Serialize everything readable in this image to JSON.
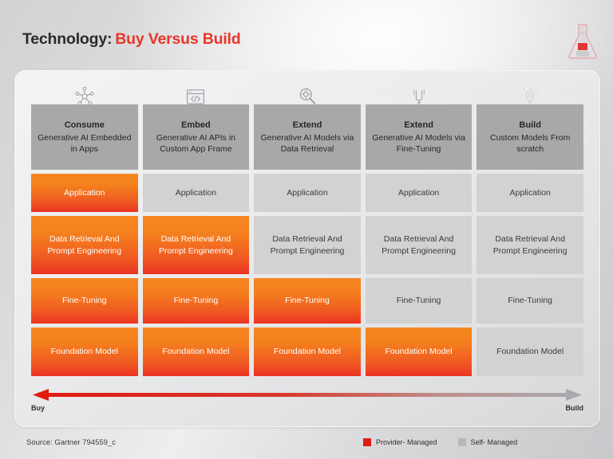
{
  "title": {
    "prefix": "Technology:",
    "highlight": "Buy Versus Build"
  },
  "logo": {
    "name": "flask-logo"
  },
  "columns": [
    {
      "icon": "network-hub-icon",
      "heading": "Consume",
      "subheading": "Generative AI Embedded in Apps"
    },
    {
      "icon": "code-window-icon",
      "heading": "Embed",
      "subheading": "Generative AI APIs in Custom App Frame"
    },
    {
      "icon": "magnifier-icon",
      "heading": "Extend",
      "subheading": "Generative AI Models via Data Retrieval"
    },
    {
      "icon": "tuning-fork-icon",
      "heading": "Extend",
      "subheading": "Generative AI Models via Fine-Tuning"
    },
    {
      "icon": "lightbulb-icon",
      "heading": "Build",
      "subheading": "Custom Models From scratch"
    }
  ],
  "rows": [
    {
      "name": "application",
      "cells": [
        {
          "label": "Application",
          "state": "provider"
        },
        {
          "label": "Application",
          "state": "self"
        },
        {
          "label": "Application",
          "state": "self"
        },
        {
          "label": "Application",
          "state": "self"
        },
        {
          "label": "Application",
          "state": "self"
        }
      ]
    },
    {
      "name": "data-retrieval-and-prompt-engineering",
      "cells": [
        {
          "label": "Data Retrieval And Prompt Engineering",
          "state": "provider"
        },
        {
          "label": "Data Retrieval And Prompt Engineering",
          "state": "provider"
        },
        {
          "label": "Data Retrieval And Prompt Engineering",
          "state": "self"
        },
        {
          "label": "Data Retrieval And Prompt Engineering",
          "state": "self"
        },
        {
          "label": "Data Retrieval And Prompt Engineering",
          "state": "self"
        }
      ]
    },
    {
      "name": "fine-tuning",
      "cells": [
        {
          "label": "Fine-Tuning",
          "state": "provider"
        },
        {
          "label": "Fine-Tuning",
          "state": "provider"
        },
        {
          "label": "Fine-Tuning",
          "state": "provider"
        },
        {
          "label": "Fine-Tuning",
          "state": "self"
        },
        {
          "label": "Fine-Tuning",
          "state": "self"
        }
      ]
    },
    {
      "name": "foundation-model",
      "cells": [
        {
          "label": "Foundation Model",
          "state": "provider"
        },
        {
          "label": "Foundation Model",
          "state": "provider"
        },
        {
          "label": "Foundation Model",
          "state": "provider"
        },
        {
          "label": "Foundation Model",
          "state": "provider"
        },
        {
          "label": "Foundation Model",
          "state": "self"
        }
      ]
    }
  ],
  "axis": {
    "left_label": "Buy",
    "right_label": "Build"
  },
  "footer": {
    "source": "Source: Gartner 794559_c"
  },
  "legend": [
    {
      "label": "Provider- Managed",
      "color": "#e01b1b"
    },
    {
      "label": "Self- Managed",
      "color": "#b8b8b8"
    }
  ],
  "colors": {
    "accent_red": "#e8372a",
    "hot_top": "#f5861f",
    "hot_bottom": "#ea3323",
    "header_gray": "#a8a8a8",
    "cell_gray": "#d2d2d2"
  }
}
